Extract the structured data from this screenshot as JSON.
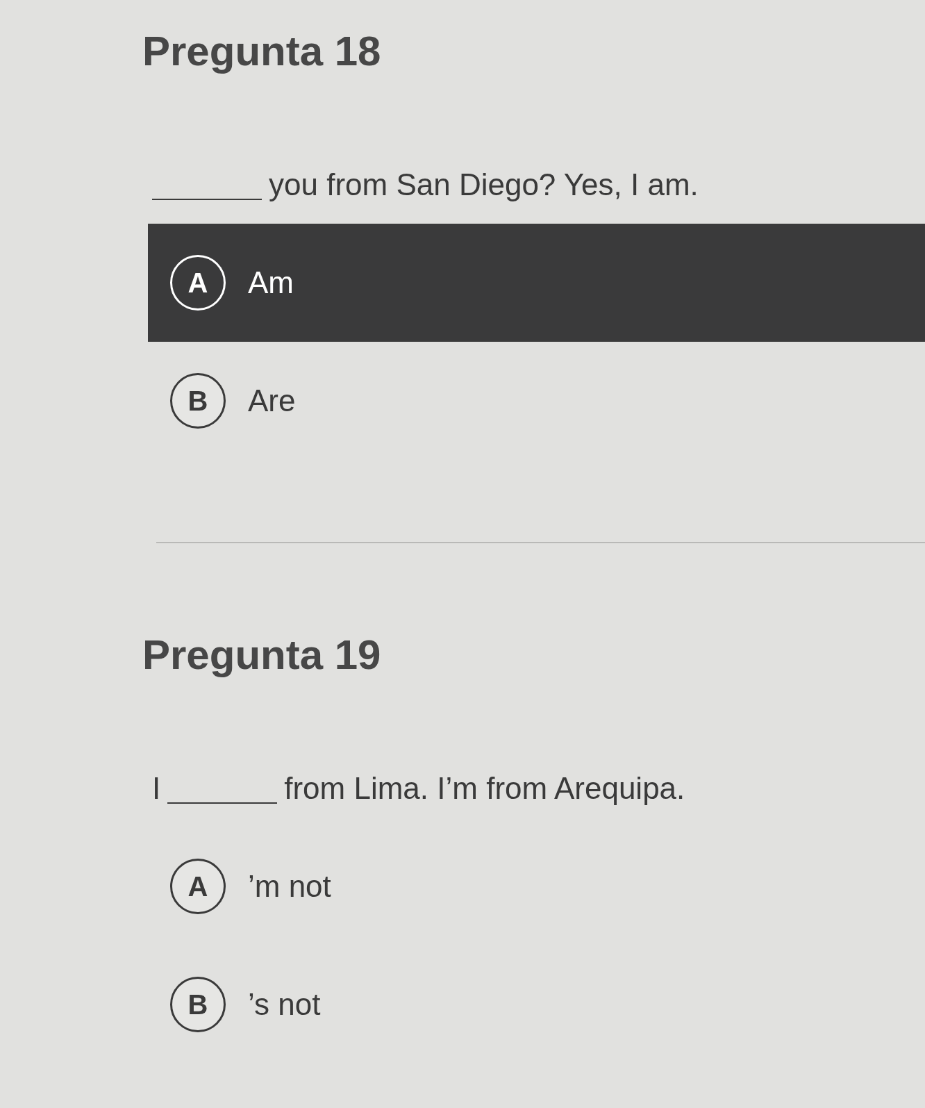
{
  "questions": [
    {
      "title": "Pregunta 18",
      "prompt": {
        "after": "you from San Diego? Yes, I am."
      },
      "options": [
        {
          "letter": "A",
          "text": "Am",
          "selected": true
        },
        {
          "letter": "B",
          "text": "Are",
          "selected": false
        }
      ]
    },
    {
      "title": "Pregunta 19",
      "prompt": {
        "before": "I",
        "after": "from Lima. I’m from Arequipa."
      },
      "options": [
        {
          "letter": "A",
          "text": "’m not",
          "selected": false
        },
        {
          "letter": "B",
          "text": "’s not",
          "selected": false
        }
      ]
    }
  ]
}
